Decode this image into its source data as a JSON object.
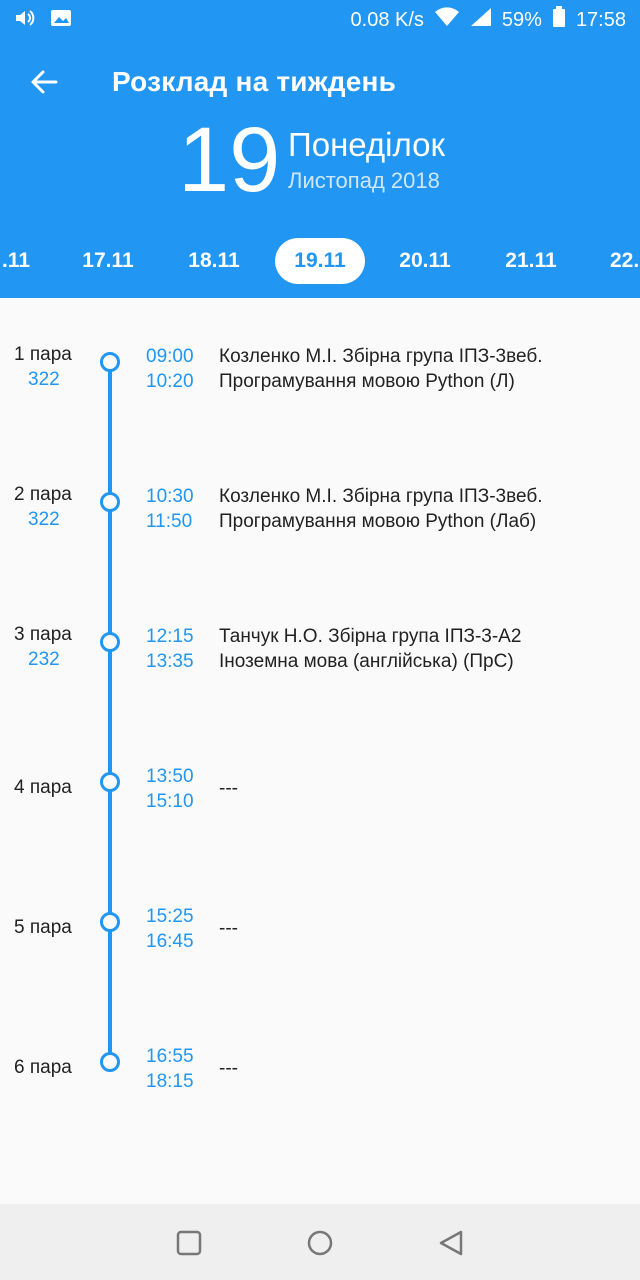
{
  "status_bar": {
    "speed": "0.08 K/s",
    "battery": "59%",
    "time": "17:58",
    "icons": [
      "volume-icon",
      "image-icon",
      "wifi-icon",
      "signal-icon",
      "battery-icon"
    ]
  },
  "header": {
    "title": "Розклад на тиждень",
    "day_number": "19",
    "weekday": "Понеділок",
    "month_year": "Листопад 2018"
  },
  "date_strip": [
    ".11",
    "17.11",
    "18.11",
    "19.11",
    "20.11",
    "21.11",
    "22."
  ],
  "date_strip_active": "19.11",
  "lessons": [
    {
      "pair": "1 пара",
      "room": "322",
      "start": "09:00",
      "end": "10:20",
      "line1": "Козленко М.І. Збірна група ІПЗ-3веб.",
      "line2": "Програмування мовою Python (Л)"
    },
    {
      "pair": "2 пара",
      "room": "322",
      "start": "10:30",
      "end": "11:50",
      "line1": "Козленко М.І. Збірна група ІПЗ-3веб.",
      "line2": "Програмування мовою Python (Лаб)"
    },
    {
      "pair": "3 пара",
      "room": "232",
      "start": "12:15",
      "end": "13:35",
      "line1": "Танчук Н.О. Збірна група ІПЗ-3-А2",
      "line2": "Іноземна мова (англійська) (ПрС)"
    },
    {
      "pair": "4 пара",
      "room": "",
      "start": "13:50",
      "end": "15:10",
      "line1": "---",
      "line2": ""
    },
    {
      "pair": "5 пара",
      "room": "",
      "start": "15:25",
      "end": "16:45",
      "line1": "---",
      "line2": ""
    },
    {
      "pair": "6 пара",
      "room": "",
      "start": "16:55",
      "end": "18:15",
      "line1": "---",
      "line2": ""
    }
  ],
  "colors": {
    "accent": "#2196f3",
    "background": "#fafafa",
    "navbar": "#efefef"
  }
}
